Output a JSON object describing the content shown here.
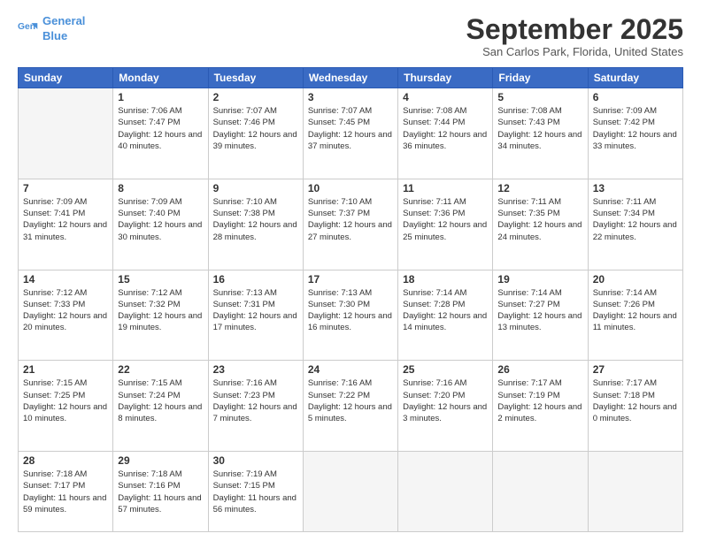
{
  "header": {
    "logo_line1": "General",
    "logo_line2": "Blue",
    "month": "September 2025",
    "location": "San Carlos Park, Florida, United States"
  },
  "days_of_week": [
    "Sunday",
    "Monday",
    "Tuesday",
    "Wednesday",
    "Thursday",
    "Friday",
    "Saturday"
  ],
  "weeks": [
    [
      {
        "num": "",
        "empty": true
      },
      {
        "num": "1",
        "sunrise": "Sunrise: 7:06 AM",
        "sunset": "Sunset: 7:47 PM",
        "daylight": "Daylight: 12 hours and 40 minutes."
      },
      {
        "num": "2",
        "sunrise": "Sunrise: 7:07 AM",
        "sunset": "Sunset: 7:46 PM",
        "daylight": "Daylight: 12 hours and 39 minutes."
      },
      {
        "num": "3",
        "sunrise": "Sunrise: 7:07 AM",
        "sunset": "Sunset: 7:45 PM",
        "daylight": "Daylight: 12 hours and 37 minutes."
      },
      {
        "num": "4",
        "sunrise": "Sunrise: 7:08 AM",
        "sunset": "Sunset: 7:44 PM",
        "daylight": "Daylight: 12 hours and 36 minutes."
      },
      {
        "num": "5",
        "sunrise": "Sunrise: 7:08 AM",
        "sunset": "Sunset: 7:43 PM",
        "daylight": "Daylight: 12 hours and 34 minutes."
      },
      {
        "num": "6",
        "sunrise": "Sunrise: 7:09 AM",
        "sunset": "Sunset: 7:42 PM",
        "daylight": "Daylight: 12 hours and 33 minutes."
      }
    ],
    [
      {
        "num": "7",
        "sunrise": "Sunrise: 7:09 AM",
        "sunset": "Sunset: 7:41 PM",
        "daylight": "Daylight: 12 hours and 31 minutes."
      },
      {
        "num": "8",
        "sunrise": "Sunrise: 7:09 AM",
        "sunset": "Sunset: 7:40 PM",
        "daylight": "Daylight: 12 hours and 30 minutes."
      },
      {
        "num": "9",
        "sunrise": "Sunrise: 7:10 AM",
        "sunset": "Sunset: 7:38 PM",
        "daylight": "Daylight: 12 hours and 28 minutes."
      },
      {
        "num": "10",
        "sunrise": "Sunrise: 7:10 AM",
        "sunset": "Sunset: 7:37 PM",
        "daylight": "Daylight: 12 hours and 27 minutes."
      },
      {
        "num": "11",
        "sunrise": "Sunrise: 7:11 AM",
        "sunset": "Sunset: 7:36 PM",
        "daylight": "Daylight: 12 hours and 25 minutes."
      },
      {
        "num": "12",
        "sunrise": "Sunrise: 7:11 AM",
        "sunset": "Sunset: 7:35 PM",
        "daylight": "Daylight: 12 hours and 24 minutes."
      },
      {
        "num": "13",
        "sunrise": "Sunrise: 7:11 AM",
        "sunset": "Sunset: 7:34 PM",
        "daylight": "Daylight: 12 hours and 22 minutes."
      }
    ],
    [
      {
        "num": "14",
        "sunrise": "Sunrise: 7:12 AM",
        "sunset": "Sunset: 7:33 PM",
        "daylight": "Daylight: 12 hours and 20 minutes."
      },
      {
        "num": "15",
        "sunrise": "Sunrise: 7:12 AM",
        "sunset": "Sunset: 7:32 PM",
        "daylight": "Daylight: 12 hours and 19 minutes."
      },
      {
        "num": "16",
        "sunrise": "Sunrise: 7:13 AM",
        "sunset": "Sunset: 7:31 PM",
        "daylight": "Daylight: 12 hours and 17 minutes."
      },
      {
        "num": "17",
        "sunrise": "Sunrise: 7:13 AM",
        "sunset": "Sunset: 7:30 PM",
        "daylight": "Daylight: 12 hours and 16 minutes."
      },
      {
        "num": "18",
        "sunrise": "Sunrise: 7:14 AM",
        "sunset": "Sunset: 7:28 PM",
        "daylight": "Daylight: 12 hours and 14 minutes."
      },
      {
        "num": "19",
        "sunrise": "Sunrise: 7:14 AM",
        "sunset": "Sunset: 7:27 PM",
        "daylight": "Daylight: 12 hours and 13 minutes."
      },
      {
        "num": "20",
        "sunrise": "Sunrise: 7:14 AM",
        "sunset": "Sunset: 7:26 PM",
        "daylight": "Daylight: 12 hours and 11 minutes."
      }
    ],
    [
      {
        "num": "21",
        "sunrise": "Sunrise: 7:15 AM",
        "sunset": "Sunset: 7:25 PM",
        "daylight": "Daylight: 12 hours and 10 minutes."
      },
      {
        "num": "22",
        "sunrise": "Sunrise: 7:15 AM",
        "sunset": "Sunset: 7:24 PM",
        "daylight": "Daylight: 12 hours and 8 minutes."
      },
      {
        "num": "23",
        "sunrise": "Sunrise: 7:16 AM",
        "sunset": "Sunset: 7:23 PM",
        "daylight": "Daylight: 12 hours and 7 minutes."
      },
      {
        "num": "24",
        "sunrise": "Sunrise: 7:16 AM",
        "sunset": "Sunset: 7:22 PM",
        "daylight": "Daylight: 12 hours and 5 minutes."
      },
      {
        "num": "25",
        "sunrise": "Sunrise: 7:16 AM",
        "sunset": "Sunset: 7:20 PM",
        "daylight": "Daylight: 12 hours and 3 minutes."
      },
      {
        "num": "26",
        "sunrise": "Sunrise: 7:17 AM",
        "sunset": "Sunset: 7:19 PM",
        "daylight": "Daylight: 12 hours and 2 minutes."
      },
      {
        "num": "27",
        "sunrise": "Sunrise: 7:17 AM",
        "sunset": "Sunset: 7:18 PM",
        "daylight": "Daylight: 12 hours and 0 minutes."
      }
    ],
    [
      {
        "num": "28",
        "sunrise": "Sunrise: 7:18 AM",
        "sunset": "Sunset: 7:17 PM",
        "daylight": "Daylight: 11 hours and 59 minutes."
      },
      {
        "num": "29",
        "sunrise": "Sunrise: 7:18 AM",
        "sunset": "Sunset: 7:16 PM",
        "daylight": "Daylight: 11 hours and 57 minutes."
      },
      {
        "num": "30",
        "sunrise": "Sunrise: 7:19 AM",
        "sunset": "Sunset: 7:15 PM",
        "daylight": "Daylight: 11 hours and 56 minutes."
      },
      {
        "num": "",
        "empty": true
      },
      {
        "num": "",
        "empty": true
      },
      {
        "num": "",
        "empty": true
      },
      {
        "num": "",
        "empty": true
      }
    ]
  ]
}
